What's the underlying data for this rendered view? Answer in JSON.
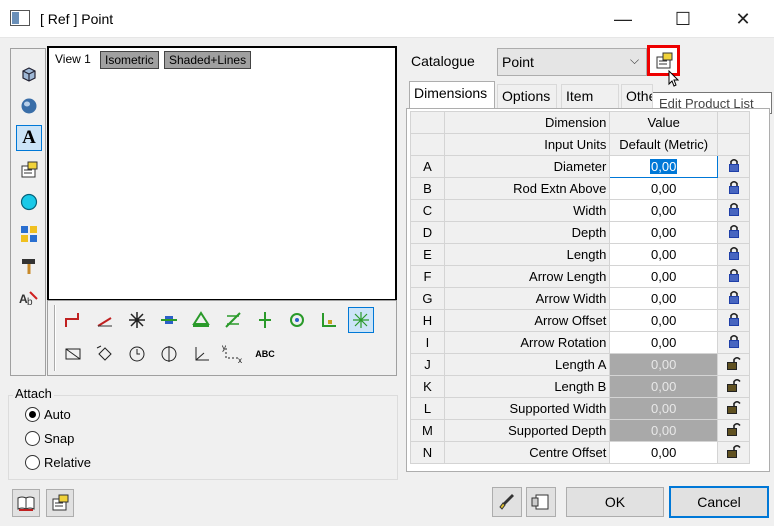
{
  "window": {
    "title": "[ Ref ]  Point",
    "minimize_glyph": "—",
    "maximize_glyph": "☐",
    "close_glyph": "✕"
  },
  "viewport": {
    "view_label": "View 1",
    "buttons": [
      "Isometric",
      "Shaded+Lines"
    ]
  },
  "attach": {
    "label": "Attach",
    "options": [
      {
        "label": "Auto",
        "checked": true
      },
      {
        "label": "Snap",
        "checked": false
      },
      {
        "label": "Relative",
        "checked": false
      }
    ]
  },
  "catalogue": {
    "label": "Catalogue",
    "value": "Point",
    "tooltip": "Edit Product List"
  },
  "tabs": [
    "Dimensions",
    "Options",
    "Item",
    "Othe"
  ],
  "grid": {
    "col_dimension": "Dimension",
    "col_value": "Value",
    "input_units_label": "Input Units",
    "input_units_value": "Default (Metric)",
    "rows": [
      {
        "key": "A",
        "name": "Diameter",
        "value": "0,00",
        "enabled": true,
        "locked": true
      },
      {
        "key": "B",
        "name": "Rod Extn Above",
        "value": "0,00",
        "enabled": true,
        "locked": true
      },
      {
        "key": "C",
        "name": "Width",
        "value": "0,00",
        "enabled": true,
        "locked": true
      },
      {
        "key": "D",
        "name": "Depth",
        "value": "0,00",
        "enabled": true,
        "locked": true
      },
      {
        "key": "E",
        "name": "Length",
        "value": "0,00",
        "enabled": true,
        "locked": true
      },
      {
        "key": "F",
        "name": "Arrow Length",
        "value": "0,00",
        "enabled": true,
        "locked": true
      },
      {
        "key": "G",
        "name": "Arrow Width",
        "value": "0,00",
        "enabled": true,
        "locked": true
      },
      {
        "key": "H",
        "name": "Arrow Offset",
        "value": "0,00",
        "enabled": true,
        "locked": true
      },
      {
        "key": "I",
        "name": "Arrow Rotation",
        "value": "0,00",
        "enabled": true,
        "locked": true
      },
      {
        "key": "J",
        "name": "Length A",
        "value": "0,00",
        "enabled": false,
        "locked": false
      },
      {
        "key": "K",
        "name": "Length B",
        "value": "0,00",
        "enabled": false,
        "locked": false
      },
      {
        "key": "L",
        "name": "Supported Width",
        "value": "0,00",
        "enabled": false,
        "locked": false
      },
      {
        "key": "M",
        "name": "Supported Depth",
        "value": "0,00",
        "enabled": false,
        "locked": false
      },
      {
        "key": "N",
        "name": "Centre Offset",
        "value": "0,00",
        "enabled": true,
        "locked": false
      }
    ]
  },
  "buttons": {
    "ok": "OK",
    "cancel": "Cancel"
  },
  "view_toolbar_text": "ABC"
}
